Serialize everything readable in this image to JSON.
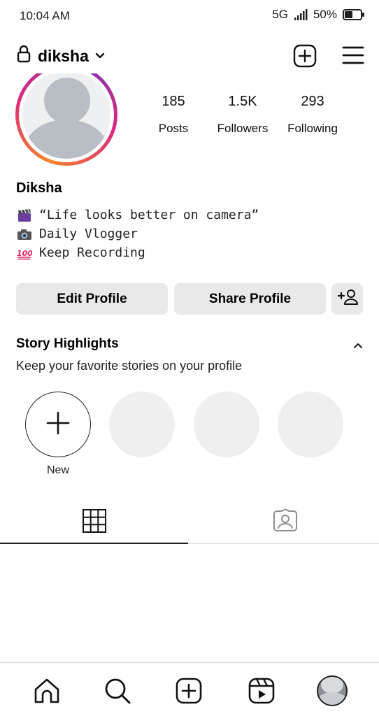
{
  "status_bar": {
    "time": "10:04 AM",
    "network": "5G",
    "battery": "50%"
  },
  "header": {
    "username": "diksha",
    "icons": [
      "lock-icon",
      "chevron-down-icon",
      "new-post-icon",
      "menu-icon"
    ]
  },
  "profile": {
    "stats": [
      {
        "value": "185",
        "label": "Posts"
      },
      {
        "value": "1.5K",
        "label": "Followers"
      },
      {
        "value": "293",
        "label": "Following"
      }
    ],
    "display_name": "Diksha",
    "bio": [
      {
        "emoji": "clapper-icon",
        "text": "“Life looks better on camera”"
      },
      {
        "emoji": "camera-icon",
        "text": "Daily Vlogger"
      },
      {
        "emoji": "hundred-icon",
        "text": "Keep Recording"
      }
    ]
  },
  "actions": {
    "edit_label": "Edit Profile",
    "share_label": "Share Profile"
  },
  "highlights": {
    "title": "Story Highlights",
    "subtitle": "Keep your favorite stories on your profile",
    "new_label": "New"
  },
  "tabs": [
    "grid-icon",
    "tagged-icon"
  ],
  "bottom_nav": [
    "home-icon",
    "search-icon",
    "create-icon",
    "reels-icon",
    "profile-avatar"
  ],
  "colors": {
    "ring_start": "#f58529",
    "ring_mid": "#dd2a7b",
    "button_bg": "#e9e9e9"
  }
}
